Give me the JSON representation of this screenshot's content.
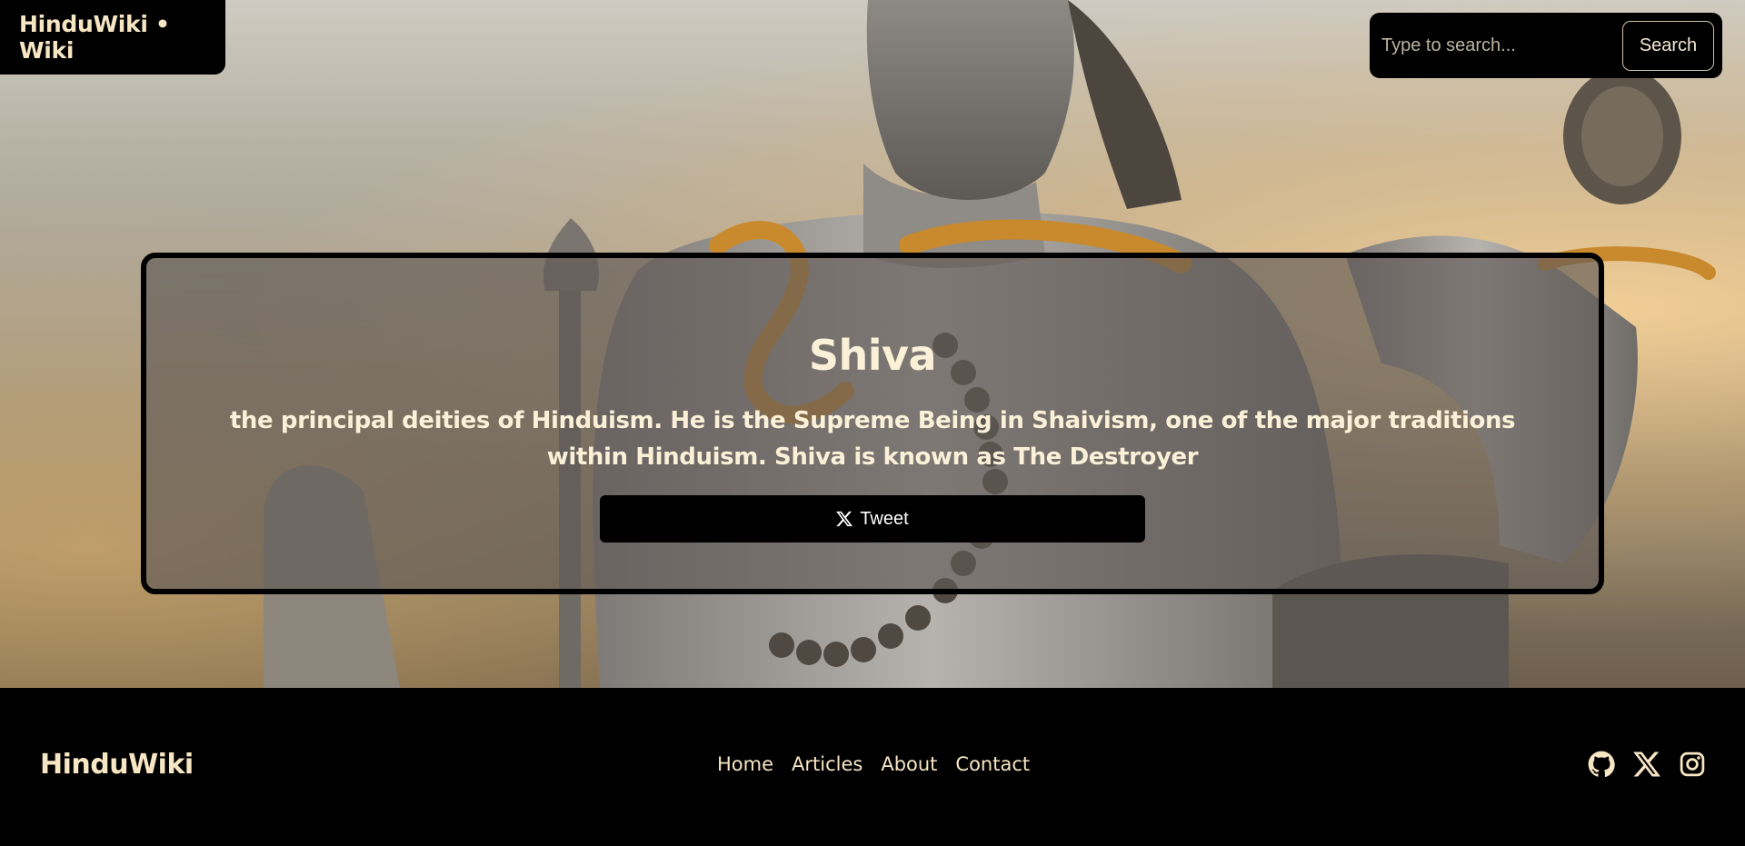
{
  "header": {
    "brand": "HinduWiki • Wiki"
  },
  "search": {
    "placeholder": "Type to search...",
    "button_label": "Search"
  },
  "hero": {
    "background_image": "statue-of-shiva-photo",
    "title": "Shiva",
    "description": "the principal deities of Hinduism. He is the Supreme Being in Shaivism, one of the major traditions within Hinduism. Shiva is known as The Destroyer",
    "tweet_label": "Tweet",
    "tweet_icon": "x-logo-icon"
  },
  "footer": {
    "brand": "HinduWiki",
    "nav": [
      {
        "label": "Home"
      },
      {
        "label": "Articles"
      },
      {
        "label": "About"
      },
      {
        "label": "Contact"
      }
    ],
    "social": [
      {
        "icon": "github-icon"
      },
      {
        "icon": "x-icon"
      },
      {
        "icon": "instagram-icon"
      }
    ]
  },
  "colors": {
    "accent_text": "#f7e6c4",
    "card_overlay": "#5f5a56",
    "background": "#000000"
  }
}
